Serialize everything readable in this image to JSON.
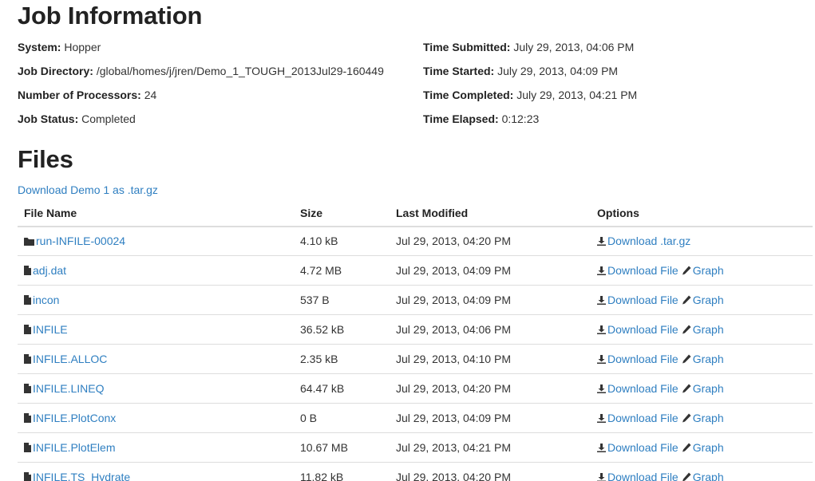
{
  "job": {
    "title": "Job Information",
    "system_label": "System:",
    "system_value": "Hopper",
    "dir_label": "Job Directory:",
    "dir_value": "/global/homes/j/jren/Demo_1_TOUGH_2013Jul29-160449",
    "procs_label": "Number of Processors:",
    "procs_value": "24",
    "status_label": "Job Status:",
    "status_value": "Completed",
    "submitted_label": "Time Submitted:",
    "submitted_value": "July 29, 2013, 04:06 PM",
    "started_label": "Time Started:",
    "started_value": "July 29, 2013, 04:09 PM",
    "completed_label": "Time Completed:",
    "completed_value": "July 29, 2013, 04:21 PM",
    "elapsed_label": "Time Elapsed:",
    "elapsed_value": "0:12:23"
  },
  "files": {
    "title": "Files",
    "download_all": "Download Demo 1 as .tar.gz",
    "headers": [
      "File Name",
      "Size",
      "Last Modified",
      "Options"
    ],
    "rows": [
      {
        "name": "run-INFILE-00024",
        "icon": "folder-icon",
        "size": "4.10 kB",
        "modified": "Jul 29, 2013, 04:20 PM",
        "download": "Download .tar.gz",
        "graph": ""
      },
      {
        "name": "adj.dat",
        "icon": "file-icon",
        "size": "4.72 MB",
        "modified": "Jul 29, 2013, 04:09 PM",
        "download": "Download File",
        "graph": "Graph"
      },
      {
        "name": "incon",
        "icon": "file-icon",
        "size": "537 B",
        "modified": "Jul 29, 2013, 04:09 PM",
        "download": "Download File",
        "graph": "Graph"
      },
      {
        "name": "INFILE",
        "icon": "file-icon",
        "size": "36.52 kB",
        "modified": "Jul 29, 2013, 04:06 PM",
        "download": "Download File",
        "graph": "Graph"
      },
      {
        "name": "INFILE.ALLOC",
        "icon": "file-icon",
        "size": "2.35 kB",
        "modified": "Jul 29, 2013, 04:10 PM",
        "download": "Download File",
        "graph": "Graph"
      },
      {
        "name": "INFILE.LINEQ",
        "icon": "file-icon",
        "size": "64.47 kB",
        "modified": "Jul 29, 2013, 04:20 PM",
        "download": "Download File",
        "graph": "Graph"
      },
      {
        "name": "INFILE.PlotConx",
        "icon": "file-icon",
        "size": "0 B",
        "modified": "Jul 29, 2013, 04:09 PM",
        "download": "Download File",
        "graph": "Graph"
      },
      {
        "name": "INFILE.PlotElem",
        "icon": "file-icon",
        "size": "10.67 MB",
        "modified": "Jul 29, 2013, 04:21 PM",
        "download": "Download File",
        "graph": "Graph"
      },
      {
        "name": "INFILE.TS_Hydrate",
        "icon": "file-icon",
        "size": "11.82 kB",
        "modified": "Jul 29, 2013, 04:20 PM",
        "download": "Download File",
        "graph": "Graph"
      }
    ]
  },
  "colors": {
    "link": "#2f7fc1",
    "text": "#333333",
    "border": "#dddddd"
  }
}
